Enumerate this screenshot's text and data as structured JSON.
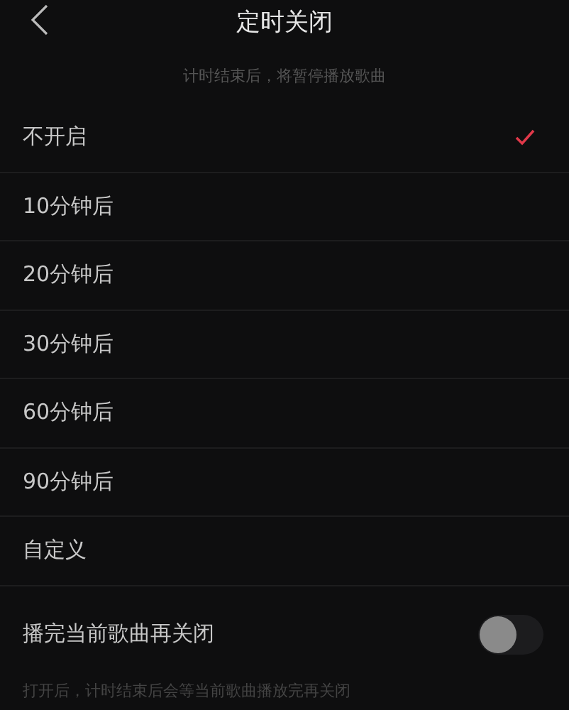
{
  "header": {
    "title": "定时关闭"
  },
  "subtitle": "计时结束后，将暂停播放歌曲",
  "options": [
    {
      "label": "不开启",
      "selected": true
    },
    {
      "label": "10分钟后",
      "selected": false
    },
    {
      "label": "20分钟后",
      "selected": false
    },
    {
      "label": "30分钟后",
      "selected": false
    },
    {
      "label": "60分钟后",
      "selected": false
    },
    {
      "label": "90分钟后",
      "selected": false
    },
    {
      "label": "自定义",
      "selected": false
    }
  ],
  "finish_song": {
    "label": "播完当前歌曲再关闭",
    "on": false,
    "note": "打开后，计时结束后会等当前歌曲播放完再关闭"
  }
}
